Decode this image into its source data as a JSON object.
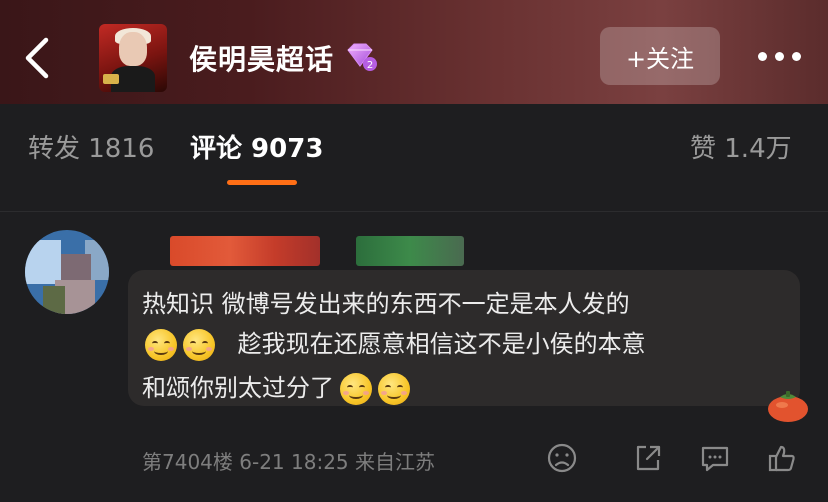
{
  "header": {
    "title": "侯明昊超话",
    "level_badge": "2",
    "follow_label": "+关注"
  },
  "tabs": [
    {
      "label": "转发 1816"
    },
    {
      "label": "评论 9073"
    },
    {
      "label": "赞 1.4万"
    }
  ],
  "comment": {
    "text_lines": [
      "热知识  微博号发出来的东西不一定是本人发的",
      "趁我现在还愿意相信这不是小侯的本意",
      "和颂你别太过分了"
    ],
    "meta": "第7404楼 6-21 18:25 来自江苏"
  },
  "icons": {
    "back": "chevron-left-icon",
    "more": "more-dots-icon",
    "dislike": "sad-face-icon",
    "share": "share-icon",
    "comment": "comment-icon",
    "like": "thumb-up-icon",
    "badge": "persimmon-badge-icon"
  },
  "colors": {
    "accent": "#ff6f16",
    "background": "#1e1e20",
    "bubble": "#2d2b2b"
  }
}
